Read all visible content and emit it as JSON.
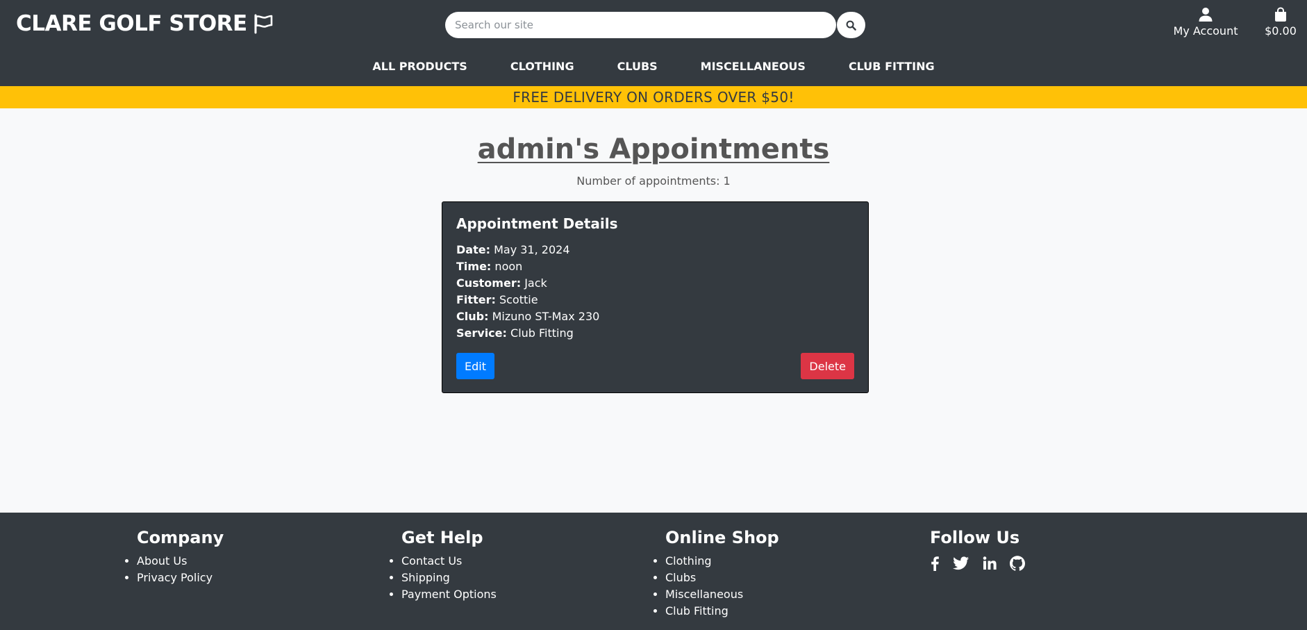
{
  "header": {
    "logo_text": "CLARE GOLF STORE",
    "search": {
      "placeholder": "Search our site",
      "value": ""
    },
    "account_label": "My Account",
    "cart_total": "$0.00"
  },
  "nav": {
    "items": [
      "ALL PRODUCTS",
      "CLOTHING",
      "CLUBS",
      "MISCELLANEOUS",
      "CLUB FITTING"
    ]
  },
  "banner": {
    "text": "FREE DELIVERY ON ORDERS OVER $50!"
  },
  "main": {
    "title": "admin's Appointments",
    "count_text": "Number of appointments: 1",
    "card": {
      "title": "Appointment Details",
      "rows": [
        {
          "label": "Date:",
          "value": "May 31, 2024"
        },
        {
          "label": "Time:",
          "value": "noon"
        },
        {
          "label": "Customer:",
          "value": "Jack"
        },
        {
          "label": "Fitter:",
          "value": "Scottie"
        },
        {
          "label": "Club:",
          "value": "Mizuno ST-Max 230"
        },
        {
          "label": "Service:",
          "value": "Club Fitting"
        }
      ],
      "edit_label": "Edit",
      "delete_label": "Delete"
    }
  },
  "footer": {
    "company": {
      "heading": "Company",
      "links": [
        "About Us",
        "Privacy Policy"
      ]
    },
    "help": {
      "heading": "Get Help",
      "links": [
        "Contact Us",
        "Shipping",
        "Payment Options"
      ]
    },
    "shop": {
      "heading": "Online Shop",
      "links": [
        "Clothing",
        "Clubs",
        "Miscellaneous",
        "Club Fitting"
      ]
    },
    "follow": {
      "heading": "Follow Us",
      "icons": [
        "facebook-icon",
        "twitter-icon",
        "linkedin-icon",
        "github-icon"
      ]
    }
  },
  "colors": {
    "dark": "#343a40",
    "banner": "#ffc107",
    "primary": "#007bff",
    "danger": "#dc3545",
    "background": "#f8f9fa"
  }
}
